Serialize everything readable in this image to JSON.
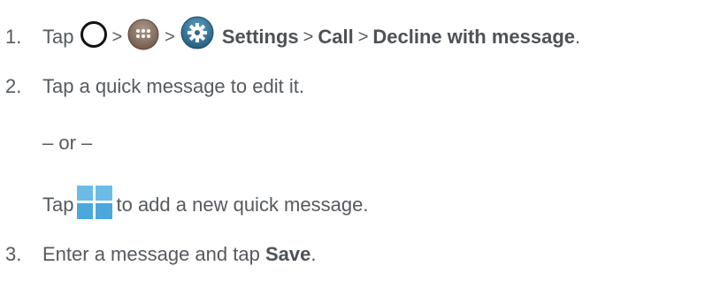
{
  "steps": [
    {
      "number": "1.",
      "prefix": "Tap",
      "separator": ">",
      "path": [
        "Settings",
        "Call",
        "Decline with message"
      ],
      "period": "."
    },
    {
      "number": "2.",
      "text": "Tap a quick message to edit it."
    },
    {
      "number": "3.",
      "text_before": "Enter a message and tap",
      "bold": "Save",
      "period": "."
    }
  ],
  "alternative": {
    "or_text": "– or –",
    "prefix": "Tap",
    "suffix": "to add a new quick message."
  },
  "icons": [
    "home-icon",
    "apps-icon",
    "settings-icon",
    "add-icon"
  ],
  "colors": {
    "text": "#555a5f",
    "apps_icon": "#7a6658",
    "settings_icon": "#2e6a8c",
    "add_icon": "#3aa0d6"
  }
}
